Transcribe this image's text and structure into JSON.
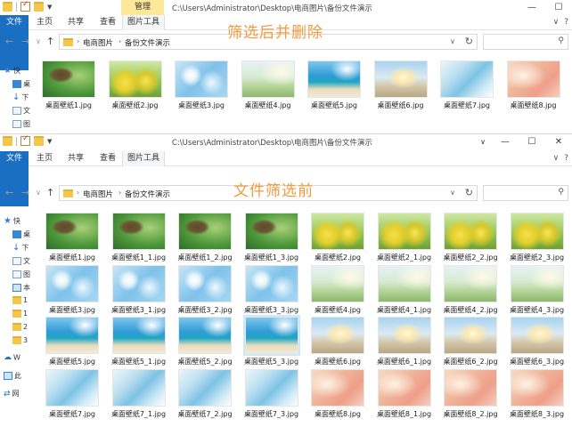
{
  "window1": {
    "manage_label": "管理",
    "path": "C:\\Users\\Administrator\\Desktop\\电商图片\\备份文件演示",
    "ribbon": {
      "file": "文件",
      "home": "主页",
      "share": "共享",
      "view": "查看",
      "tools": "图片工具"
    },
    "crumbs": [
      "电商图片",
      "备份文件演示"
    ],
    "overlay": "筛选后并删除",
    "nav": [
      "快",
      "桌",
      "下",
      "文",
      "图"
    ],
    "files": [
      {
        "name": "桌面壁纸1.jpg",
        "img": "frog"
      },
      {
        "name": "桌面壁纸2.jpg",
        "img": "flower"
      },
      {
        "name": "桌面壁纸3.jpg",
        "img": "bokeh"
      },
      {
        "name": "桌面壁纸4.jpg",
        "img": "field"
      },
      {
        "name": "桌面壁纸5.jpg",
        "img": "beach"
      },
      {
        "name": "桌面壁纸6.jpg",
        "img": "sea"
      },
      {
        "name": "桌面壁纸7.jpg",
        "img": "glass"
      },
      {
        "name": "桌面壁纸8.jpg",
        "img": "petal"
      }
    ]
  },
  "window2": {
    "path": "C:\\Users\\Administrator\\Desktop\\电商图片\\备份文件演示",
    "ribbon": {
      "file": "文件",
      "home": "主页",
      "share": "共享",
      "view": "查看",
      "tools": "图片工具"
    },
    "crumbs": [
      "电商图片",
      "备份文件演示"
    ],
    "overlay": "文件筛选前",
    "nav": [
      "快",
      "桌",
      "下",
      "文",
      "图",
      "本",
      "1",
      "1",
      "2",
      "3",
      "W",
      "此",
      "网"
    ],
    "files": [
      {
        "name": "桌面壁纸1.jpg",
        "img": "frog"
      },
      {
        "name": "桌面壁纸1_1.jpg",
        "img": "frog"
      },
      {
        "name": "桌面壁纸1_2.jpg",
        "img": "frog"
      },
      {
        "name": "桌面壁纸1_3.jpg",
        "img": "frog"
      },
      {
        "name": "桌面壁纸2.jpg",
        "img": "flower"
      },
      {
        "name": "桌面壁纸2_1.jpg",
        "img": "flower"
      },
      {
        "name": "桌面壁纸2_2.jpg",
        "img": "flower"
      },
      {
        "name": "桌面壁纸2_3.jpg",
        "img": "flower"
      },
      {
        "name": "桌面壁纸3.jpg",
        "img": "bokeh"
      },
      {
        "name": "桌面壁纸3_1.jpg",
        "img": "bokeh"
      },
      {
        "name": "桌面壁纸3_2.jpg",
        "img": "bokeh"
      },
      {
        "name": "桌面壁纸3_3.jpg",
        "img": "bokeh"
      },
      {
        "name": "桌面壁纸4.jpg",
        "img": "field"
      },
      {
        "name": "桌面壁纸4_1.jpg",
        "img": "field"
      },
      {
        "name": "桌面壁纸4_2.jpg",
        "img": "field"
      },
      {
        "name": "桌面壁纸4_3.jpg",
        "img": "field"
      },
      {
        "name": "桌面壁纸5.jpg",
        "img": "beach"
      },
      {
        "name": "桌面壁纸5_1.jpg",
        "img": "beach"
      },
      {
        "name": "桌面壁纸5_2.jpg",
        "img": "beach"
      },
      {
        "name": "桌面壁纸5_3.jpg",
        "img": "beach",
        "selected": true
      },
      {
        "name": "桌面壁纸6.jpg",
        "img": "sea"
      },
      {
        "name": "桌面壁纸6_1.jpg",
        "img": "sea"
      },
      {
        "name": "桌面壁纸6_2.jpg",
        "img": "sea"
      },
      {
        "name": "桌面壁纸6_3.jpg",
        "img": "sea"
      },
      {
        "name": "桌面壁纸7.jpg",
        "img": "glass"
      },
      {
        "name": "桌面壁纸7_1.jpg",
        "img": "glass"
      },
      {
        "name": "桌面壁纸7_2.jpg",
        "img": "glass"
      },
      {
        "name": "桌面壁纸7_3.jpg",
        "img": "glass"
      },
      {
        "name": "桌面壁纸8.jpg",
        "img": "petal"
      },
      {
        "name": "桌面壁纸8_1.jpg",
        "img": "petal"
      },
      {
        "name": "桌面壁纸8_2.jpg",
        "img": "petal"
      },
      {
        "name": "桌面壁纸8_3.jpg",
        "img": "petal"
      }
    ]
  }
}
